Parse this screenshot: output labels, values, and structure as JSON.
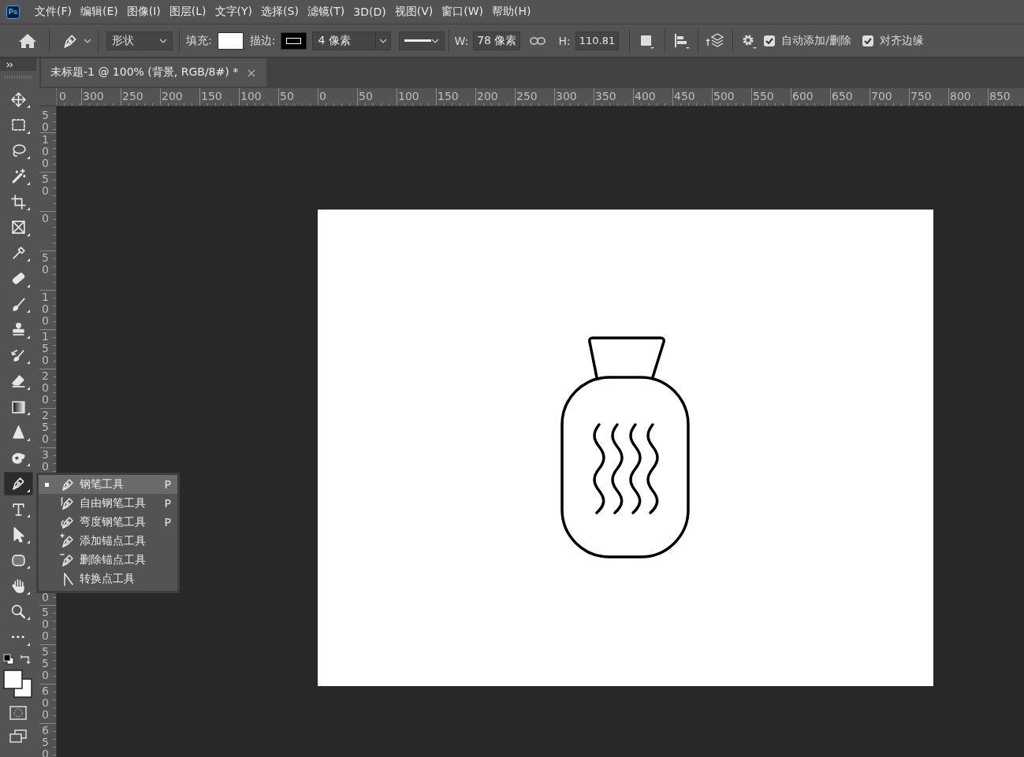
{
  "app_logo": "Ps",
  "menu_bar": [
    "文件(F)",
    "编辑(E)",
    "图像(I)",
    "图层(L)",
    "文字(Y)",
    "选择(S)",
    "滤镜(T)",
    "3D(D)",
    "视图(V)",
    "窗口(W)",
    "帮助(H)"
  ],
  "options_bar": {
    "mode": "形状",
    "fill_label": "填充:",
    "stroke_label": "描边:",
    "stroke_width": "4 像素",
    "width_label": "W:",
    "width_value": "78 像素",
    "height_label": "H:",
    "height_value": "110.81",
    "checkboxes": [
      {
        "label": "自动添加/删除",
        "checked": true
      },
      {
        "label": "对齐边缘",
        "checked": true
      }
    ]
  },
  "document_tab": {
    "title": "未标题-1 @ 100% (背景, RGB/8#) *",
    "close": "×"
  },
  "rulers": {
    "horizontal": [
      {
        "text": "0",
        "kind": "tail"
      },
      {
        "text": "300",
        "kind": "full"
      },
      {
        "text": "250",
        "kind": "full"
      },
      {
        "text": "200",
        "kind": "full"
      },
      {
        "text": "150",
        "kind": "full"
      },
      {
        "text": "100",
        "kind": "full"
      },
      {
        "text": "50",
        "kind": "full"
      },
      {
        "text": "0",
        "kind": "full"
      },
      {
        "text": "50",
        "kind": "full"
      },
      {
        "text": "100",
        "kind": "full"
      },
      {
        "text": "150",
        "kind": "full"
      },
      {
        "text": "200",
        "kind": "full"
      },
      {
        "text": "250",
        "kind": "full"
      },
      {
        "text": "300",
        "kind": "full"
      },
      {
        "text": "350",
        "kind": "full"
      },
      {
        "text": "400",
        "kind": "full"
      },
      {
        "text": "450",
        "kind": "full"
      },
      {
        "text": "500",
        "kind": "full"
      },
      {
        "text": "550",
        "kind": "full"
      },
      {
        "text": "600",
        "kind": "full"
      },
      {
        "text": "650",
        "kind": "full"
      },
      {
        "text": "700",
        "kind": "full"
      },
      {
        "text": "750",
        "kind": "full"
      },
      {
        "text": "800",
        "kind": "full"
      },
      {
        "text": "850",
        "kind": "full"
      }
    ],
    "vertical": [
      {
        "text": "50",
        "kind": "tail"
      },
      {
        "text": "100",
        "kind": "full"
      },
      {
        "text": "50",
        "kind": "full"
      },
      {
        "text": "0",
        "kind": "full"
      },
      {
        "text": "50",
        "kind": "full"
      },
      {
        "text": "100",
        "kind": "full"
      },
      {
        "text": "150",
        "kind": "full"
      },
      {
        "text": "200",
        "kind": "full"
      },
      {
        "text": "250",
        "kind": "full"
      },
      {
        "text": "30",
        "kind": "full"
      },
      {
        "text": "0",
        "kind": "tail"
      },
      {
        "text": "500",
        "kind": "full"
      },
      {
        "text": "550",
        "kind": "full"
      },
      {
        "text": "600",
        "kind": "full"
      },
      {
        "text": "650",
        "kind": "full"
      }
    ]
  },
  "tools": [
    {
      "kind": "move",
      "selected": false
    },
    {
      "kind": "marquee",
      "selected": false
    },
    {
      "kind": "lasso",
      "selected": false
    },
    {
      "kind": "magic-wand",
      "selected": false
    },
    {
      "kind": "crop",
      "selected": false
    },
    {
      "kind": "frame",
      "selected": false
    },
    {
      "kind": "eyedropper",
      "selected": false
    },
    {
      "kind": "healing",
      "selected": false
    },
    {
      "kind": "brush",
      "selected": false
    },
    {
      "kind": "stamp",
      "selected": false
    },
    {
      "kind": "history-brush",
      "selected": false
    },
    {
      "kind": "eraser",
      "selected": false
    },
    {
      "kind": "gradient",
      "selected": false
    },
    {
      "kind": "sharpen",
      "selected": false
    },
    {
      "kind": "smudge",
      "selected": false
    },
    {
      "kind": "pen",
      "selected": true
    },
    {
      "kind": "type",
      "selected": false
    },
    {
      "kind": "path-select",
      "selected": false
    },
    {
      "kind": "rectangle",
      "selected": false
    },
    {
      "kind": "hand",
      "selected": false
    },
    {
      "kind": "zoom",
      "selected": false
    },
    {
      "kind": "more",
      "selected": false
    }
  ],
  "tool_flyout": [
    {
      "kind": "pen",
      "label": "钢笔工具",
      "shortcut": "P",
      "selected": true
    },
    {
      "kind": "freeform-pen",
      "label": "自由钢笔工具",
      "shortcut": "P",
      "selected": false
    },
    {
      "kind": "curvature-pen",
      "label": "弯度钢笔工具",
      "shortcut": "P",
      "selected": false
    },
    {
      "kind": "add-anchor",
      "label": "添加锚点工具",
      "selected": false
    },
    {
      "kind": "delete-anchor",
      "label": "删除锚点工具",
      "selected": false
    },
    {
      "kind": "convert-point",
      "label": "转换点工具",
      "selected": false
    }
  ]
}
